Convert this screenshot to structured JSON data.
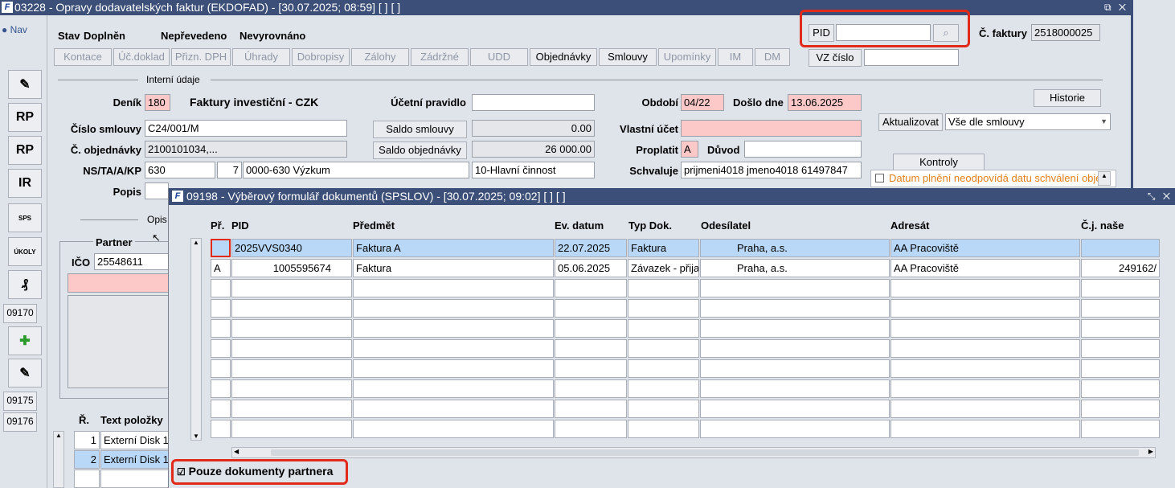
{
  "window": {
    "title": "03228 - Opravy dodavatelských faktur (EKDOFAD) - [30.07.2025; 08:59]  [ ] [ ]",
    "controls": "⧉ ✕"
  },
  "nav_label": "Nav",
  "status": {
    "stav_label": "Stav",
    "stav_value": "Doplněn",
    "neprevedeno": "Nepřevedeno",
    "nevyrovnano": "Nevyrovnáno"
  },
  "pid": {
    "button": "PID",
    "value": ""
  },
  "faktura": {
    "label": "Č. faktury",
    "value": "2518000025"
  },
  "vz": {
    "button": "VZ číslo",
    "value": ""
  },
  "toolbar": [
    "Kontace",
    "Úč.doklad",
    "Přizn. DPH",
    "Úhrady",
    "Dobropisy",
    "Zálohy",
    "Zádržné",
    "UDD",
    "Objednávky",
    "Smlouvy",
    "Upomínky",
    "IM",
    "DM"
  ],
  "interni_udaje": "Interní údaje",
  "denik": {
    "label": "Deník",
    "code": "180",
    "name": "Faktury investiční - CZK"
  },
  "ucetni_pravidlo": {
    "label": "Účetní pravidlo",
    "value": ""
  },
  "obdobi": {
    "label": "Období",
    "value": "04/22"
  },
  "doslo_dne": {
    "label": "Došlo dne",
    "value": "13.06.2025"
  },
  "historie": "Historie",
  "cislo_smlouvy": {
    "label": "Číslo smlouvy",
    "value": "C24/001/M"
  },
  "saldo_smlouvy": {
    "button": "Saldo smlouvy",
    "value": "0.00"
  },
  "vlastni_ucet": {
    "label": "Vlastní účet",
    "value": ""
  },
  "aktualizovat": {
    "button": "Aktualizovat",
    "option": "Vše dle smlouvy"
  },
  "c_objednavky": {
    "label": "Č. objednávky",
    "value": "2100101034,..."
  },
  "saldo_objednavky": {
    "button": "Saldo objednávky",
    "value": "26 000.00"
  },
  "proplatit": {
    "label": "Proplatit",
    "value": "A"
  },
  "duvod": {
    "label": "Důvod",
    "value": ""
  },
  "kontroly": "Kontroly",
  "ns": {
    "label": "NS/TA/A/KP",
    "v1": "630",
    "v2": "7",
    "v3": "0000-630 Výzkum",
    "v4": "10-Hlavní činnost"
  },
  "schvaluje": {
    "label": "Schvaluje",
    "value": "prijmeni4018 jmeno4018 61497847"
  },
  "kontrola_msg": "Datum plnění neodpovídá datu schválení obje",
  "popis": {
    "label": "Popis"
  },
  "opis_label": "Opis",
  "partner": {
    "label": "Partner",
    "ico_label": "IČO",
    "ico_value": "25548611"
  },
  "sidebar": {
    "rp1": "RP",
    "rp2": "RP",
    "ir": "IR",
    "sps": "SPS",
    "ukoly": "ÚKOLY",
    "b1": "09170",
    "b2": "09175",
    "b3": "09176"
  },
  "items": {
    "col_r": "Ř.",
    "col_text": "Text položky",
    "rows": [
      {
        "r": "1",
        "text": "Externí Disk 1"
      },
      {
        "r": "2",
        "text": "Externí Disk 1"
      }
    ]
  },
  "modal": {
    "title": "09198 - Výběrový formulář dokumentů (SPSLOV) - [30.07.2025; 09:02]  [ ] [ ]",
    "columns": [
      "Př.",
      "PID",
      "Předmět",
      "Ev. datum",
      "Typ Dok.",
      "Odesílatel",
      "Adresát",
      "Č.j. naše"
    ],
    "rows": [
      {
        "pr": "",
        "pid": "2025VVS0340",
        "predmet": "Faktura A",
        "datum": "22.07.2025",
        "typ": "Faktura",
        "odesilatel": "Praha, a.s.",
        "adresat": "AA Pracoviště",
        "cj": ""
      },
      {
        "pr": "A",
        "pid": "1005595674",
        "predmet": "Faktura",
        "datum": "05.06.2025",
        "typ": "Závazek - přija",
        "odesilatel": "Praha, a.s.",
        "adresat": "AA Pracoviště",
        "cj": "249162/"
      }
    ],
    "checkbox_label": "Pouze dokumenty partnera",
    "checkbox_checked": true
  }
}
